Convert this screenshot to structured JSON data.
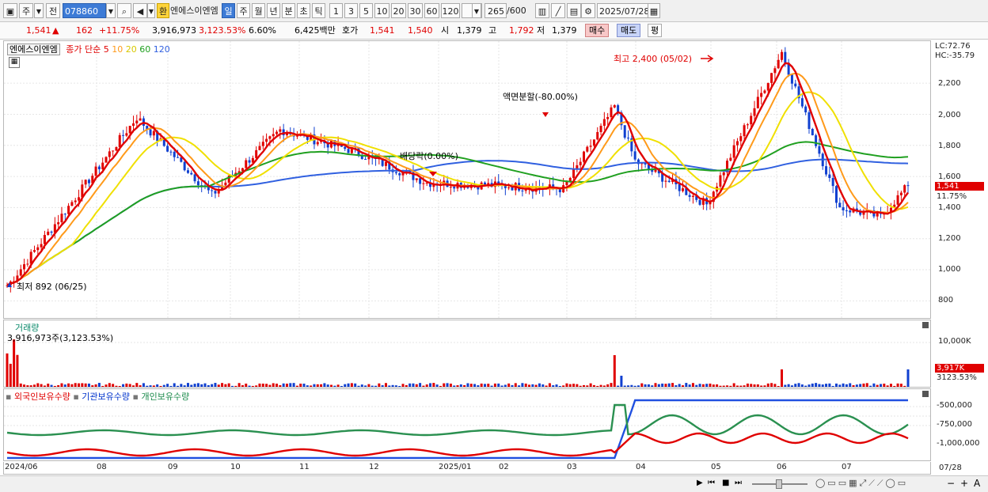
{
  "toolbar": {
    "main_label": "주",
    "prev_label": "전",
    "code_value": "078860",
    "currency_label": "환",
    "stock_name": "엔에스이엔엠",
    "period_tabs": [
      "일",
      "주",
      "월",
      "년",
      "분",
      "초",
      "틱"
    ],
    "interval_buttons": [
      "1",
      "3",
      "5",
      "10",
      "20",
      "30",
      "60",
      "120"
    ],
    "count_value": "265",
    "count_total": "/600",
    "date_value": "2025/07/28"
  },
  "quote": {
    "price": "1,541",
    "change_arrow": "▲",
    "change": "162",
    "change_pct": "+11.75%",
    "volume": "3,916,973",
    "volume_ratio": "3,123.53%",
    "turnover": "6.60%",
    "amount": "6,425백만",
    "hoga_label": "호가",
    "ask": "1,541",
    "bid": "1,540",
    "open_label": "시",
    "open": "1,379",
    "high_label": "고",
    "high": "1,792",
    "low_label": "저",
    "low": "1,379",
    "buy_label": "매수",
    "sell_label": "매도",
    "eval_label": "평"
  },
  "price_panel": {
    "name": "엔에스이엔엠",
    "legend_prefix": "종가 단순",
    "ma_labels": [
      "5",
      "10",
      "20",
      "60",
      "120"
    ],
    "lc": "LC:72.76",
    "hc": "HC:-35.79",
    "y_labels": [
      "2,200",
      "2,000",
      "1,800",
      "1,600",
      "1,400",
      "1,200",
      "1,000",
      "800"
    ],
    "current_tag": "1,541",
    "current_pct": "11.75%",
    "high_annotation": "최고 2,400 (05/02)",
    "low_annotation": "최저 892 (06/25)",
    "split_annotation": "액면분할(-80.00%)",
    "dividend_annotation": "배당락(0.00%)"
  },
  "volume_panel": {
    "title": "거래량",
    "value_label": "3,916,973주(3,123.53%)",
    "y_label": "10,000K",
    "current_tag": "3,917K",
    "current_pct": "3123.53%"
  },
  "holding_panel": {
    "legend": [
      "외국인보유수량",
      "기관보유수량",
      "개인보유수량"
    ],
    "y_labels": [
      "-500,000",
      "-750,000",
      "-1,000,000"
    ]
  },
  "x_axis": {
    "labels": [
      "2024/06",
      "08",
      "09",
      "10",
      "11",
      "12",
      "2025/01",
      "02",
      "03",
      "04",
      "05",
      "06",
      "07"
    ],
    "right_label": "07/28"
  },
  "chart_data": {
    "type": "candlestick",
    "x_start": "2024/06",
    "x_end": "2025/07/28",
    "y_range": [
      800,
      2400
    ],
    "series_colors": {
      "ma5": "#e00000",
      "ma10": "#ff9a1a",
      "ma20": "#f0e000",
      "ma60": "#20a020",
      "ma120": "#3060e0"
    },
    "close_samples": [
      {
        "x": "2024/06/25",
        "y": 892
      },
      {
        "x": "2024/08",
        "y": 1980
      },
      {
        "x": "2024/09",
        "y": 1480
      },
      {
        "x": "2024/10",
        "y": 1900
      },
      {
        "x": "2024/11",
        "y": 1760
      },
      {
        "x": "2024/12",
        "y": 1560
      },
      {
        "x": "2025/01",
        "y": 1540
      },
      {
        "x": "2025/02",
        "y": 1520
      },
      {
        "x": "2025/02/20",
        "y": 2050
      },
      {
        "x": "2025/03",
        "y": 1700
      },
      {
        "x": "2025/04",
        "y": 1420
      },
      {
        "x": "2025/05/02",
        "y": 2400
      },
      {
        "x": "2025/06",
        "y": 1400
      },
      {
        "x": "2025/07",
        "y": 1340
      },
      {
        "x": "2025/07/28",
        "y": 1541
      }
    ]
  }
}
